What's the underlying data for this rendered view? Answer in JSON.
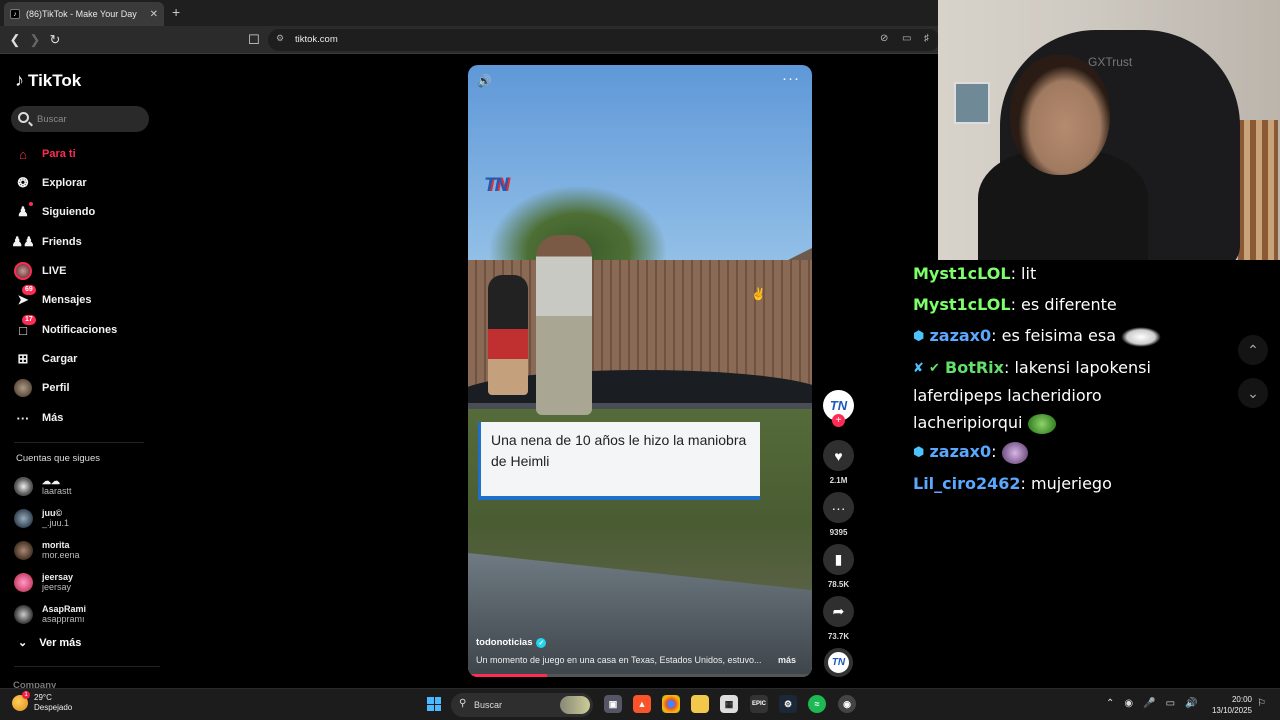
{
  "browser": {
    "tab_title": "(86)TikTok - Make Your Day",
    "url": "tiktok.com"
  },
  "sidebar": {
    "logo": "TikTok",
    "search_placeholder": "Buscar",
    "nav": [
      {
        "label": "Para ti",
        "icon": "home-icon",
        "active": true
      },
      {
        "label": "Explorar",
        "icon": "compass-icon"
      },
      {
        "label": "Siguiendo",
        "icon": "following-icon"
      },
      {
        "label": "Friends",
        "icon": "friends-icon"
      },
      {
        "label": "LIVE",
        "icon": "live-icon"
      },
      {
        "label": "Mensajes",
        "icon": "messages-icon",
        "badge": "69"
      },
      {
        "label": "Notificaciones",
        "icon": "notifications-icon",
        "badge": "17"
      },
      {
        "label": "Cargar",
        "icon": "upload-icon"
      },
      {
        "label": "Perfil",
        "icon": "profile-icon"
      },
      {
        "label": "Más",
        "icon": "more-icon"
      }
    ],
    "following_title": "Cuentas que sigues",
    "following": [
      {
        "name": "☁☁",
        "handle": "laarastt"
      },
      {
        "name": "juu©",
        "handle": "_.juu.1"
      },
      {
        "name": "morita",
        "handle": "mor.eena"
      },
      {
        "name": "jeersay",
        "handle": "jeersay"
      },
      {
        "name": "AsapRami",
        "handle": "asappramı"
      }
    ],
    "see_more": "Ver más",
    "company": "Company"
  },
  "video": {
    "overlay_logo": "TN",
    "caption": "Una nena de 10 años le hizo la maniobra de Heimli",
    "author": "todonoticias",
    "description": "Un momento de juego en una casa en Texas, Estados Unidos, estuvo...",
    "more_label": "más",
    "progress": 0.23
  },
  "actions": {
    "avatar_text": "TN",
    "likes": "2.1M",
    "comments": "9395",
    "saves": "78.5K",
    "shares": "73.7K"
  },
  "webcam": {
    "chair_text": "GXTrust"
  },
  "chat": [
    {
      "user": "Myst1cLOL",
      "text": "lit",
      "color": "#7dff6a"
    },
    {
      "user": "Myst1cLOL",
      "text": "es diferente",
      "color": "#7dff6a"
    },
    {
      "user": "zazax0",
      "text": "es feisima esa",
      "color": "#5ba8ff"
    },
    {
      "user": "BotRix",
      "text": "lakensi lapokensi laferdipeps lacheridioro lacheripiorqui",
      "color": "#63e06a"
    },
    {
      "user": "zazax0",
      "text": "",
      "color": "#5ba8ff"
    },
    {
      "user": "Lil_ciro2462",
      "text": "mujeriego",
      "color": "#5ba8ff"
    }
  ],
  "taskbar": {
    "temperature": "29°C",
    "weather": "Despejado",
    "weather_badge": "1",
    "search_label": "Buscar",
    "time": "20:00",
    "date": "13/10/2025"
  }
}
